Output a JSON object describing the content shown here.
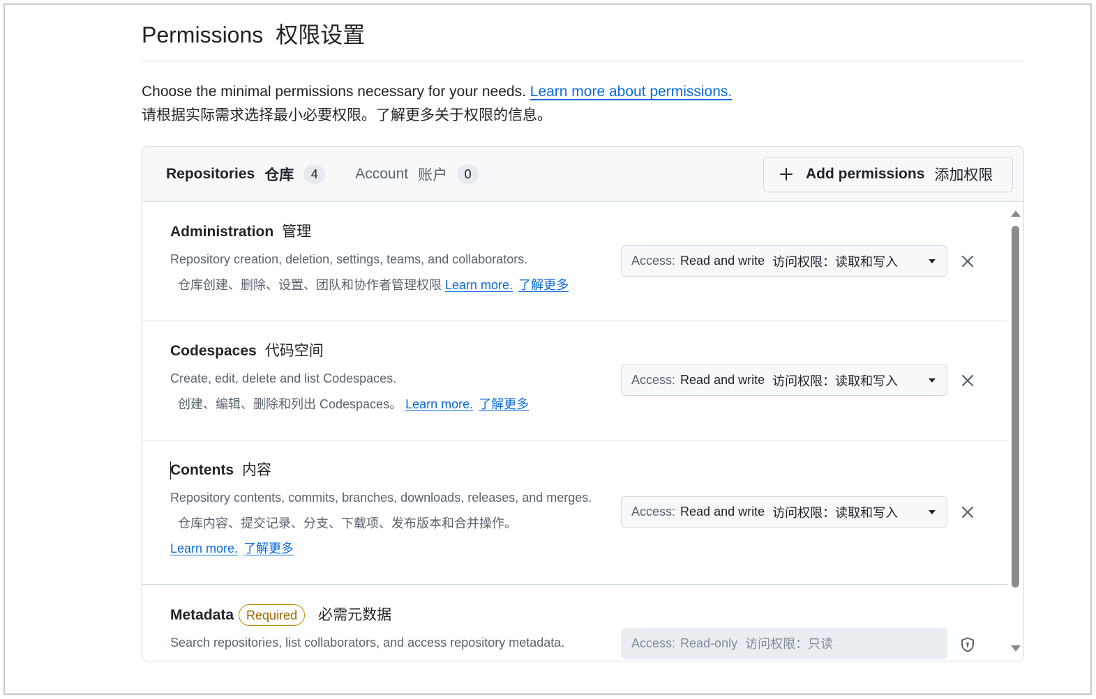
{
  "page": {
    "title": "Permissions",
    "title_zh": "权限设置",
    "intro_text": "Choose the minimal permissions necessary for your needs.",
    "intro_link": "Learn more about permissions.",
    "intro_zh": "请根据实际需求选择最小必要权限。了解更多关于权限的信息。"
  },
  "tabs": [
    {
      "label": "Repositories",
      "label_zh": "仓库",
      "count": "4",
      "selected": true
    },
    {
      "label": "Account",
      "label_zh": "账户",
      "count": "0",
      "selected": false
    }
  ],
  "add_permissions": {
    "label": "Add permissions",
    "label_zh": "添加权限",
    "icon": "plus-icon"
  },
  "learn_more": {
    "label": "Learn more.",
    "label_zh": "了解更多"
  },
  "permissions": [
    {
      "name": "Administration",
      "name_zh": "管理",
      "description": "Repository creation, deletion, settings, teams, and collaborators.",
      "description_zh": "仓库创建、删除、设置、团队和协作者管理权限",
      "access": {
        "label": "Access:",
        "value": "Read and write",
        "value_zh": "访问权限：读取和写入",
        "disabled": false
      },
      "action_icon": "x-icon"
    },
    {
      "name": "Codespaces",
      "name_zh": "代码空间",
      "description": "Create, edit, delete and list Codespaces.",
      "description_zh": "创建、编辑、删除和列出 Codespaces。",
      "access": {
        "label": "Access:",
        "value": "Read and write",
        "value_zh": "访问权限：读取和写入",
        "disabled": false
      },
      "action_icon": "x-icon"
    },
    {
      "name": "Contents",
      "name_zh": "内容",
      "description": "Repository contents, commits, branches, downloads, releases, and merges.",
      "description_zh": "仓库内容、提交记录、分支、下载项、发布版本和合并操作。",
      "access": {
        "label": "Access:",
        "value": "Read and write",
        "value_zh": "访问权限：读取和写入",
        "disabled": false
      },
      "action_icon": "x-icon"
    },
    {
      "name": "Metadata",
      "badge": "Required",
      "name_zh": "必需元数据",
      "description": "Search repositories, list collaborators, and access repository metadata.",
      "access": {
        "label": "Access:",
        "value": "Read-only",
        "value_zh": "访问权限：只读",
        "disabled": true
      },
      "action_icon": "shield-lock-icon"
    }
  ],
  "scrollbar": {
    "up_icon": "triangle-up-icon",
    "down_icon": "triangle-down-icon"
  },
  "colors": {
    "text": "#1f2328",
    "muted": "#59636e",
    "link": "#0969da",
    "border": "#d1d9e0",
    "header_bg": "#f6f8fa",
    "required_badge": "#9a6700",
    "disabled_select_bg": "#eaeef2"
  }
}
